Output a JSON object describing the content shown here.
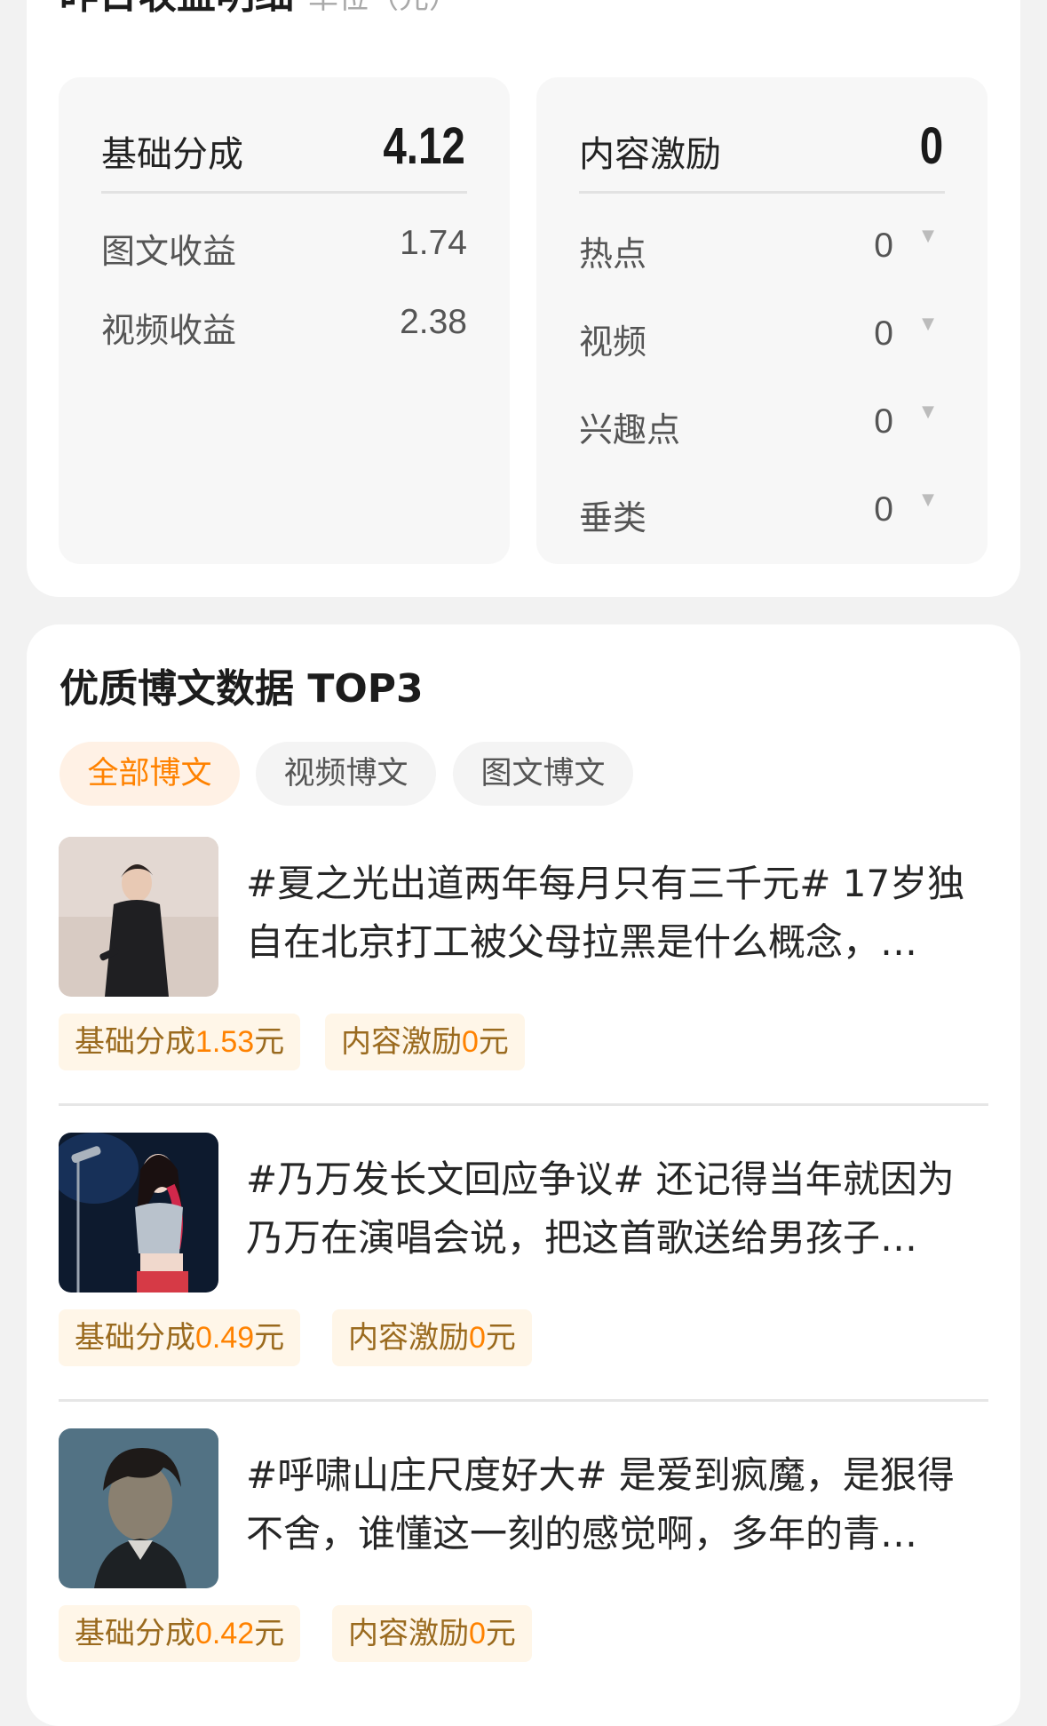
{
  "earnings": {
    "title": "昨日收益明细",
    "unit": "单位（元）",
    "basic": {
      "label": "基础分成",
      "total": "4.12",
      "items": [
        {
          "label": "图文收益",
          "value": "1.74"
        },
        {
          "label": "视频收益",
          "value": "2.38"
        }
      ]
    },
    "incentive": {
      "label": "内容激励",
      "total": "0",
      "items": [
        {
          "label": "热点",
          "value": "0"
        },
        {
          "label": "视频",
          "value": "0"
        },
        {
          "label": "兴趣点",
          "value": "0"
        },
        {
          "label": "垂类",
          "value": "0"
        }
      ]
    }
  },
  "top3": {
    "title": "优质博文数据 TOP3",
    "tabs": [
      {
        "label": "全部博文",
        "active": true
      },
      {
        "label": "视频博文",
        "active": false
      },
      {
        "label": "图文博文",
        "active": false
      }
    ],
    "posts": [
      {
        "line1": "#夏之光出道两年每月只有三千元# 17岁独",
        "line2": "自在北京打工被父母拉黑是什么概念，…",
        "basic_label": "基础分成",
        "basic_amount": "1.53",
        "incentive_label": "内容激励",
        "incentive_amount": "0",
        "currency": "元"
      },
      {
        "line1": "#乃万发长文回应争议# 还记得当年就因为",
        "line2": "乃万在演唱会说，把这首歌送给男孩子…",
        "basic_label": "基础分成",
        "basic_amount": "0.49",
        "incentive_label": "内容激励",
        "incentive_amount": "0",
        "currency": "元"
      },
      {
        "line1": "#呼啸山庄尺度好大# 是爱到疯魔，是狠得",
        "line2": "不舍，谁懂这一刻的感觉啊，多年的青…",
        "basic_label": "基础分成",
        "basic_amount": "0.42",
        "incentive_label": "内容激励",
        "incentive_amount": "0",
        "currency": "元"
      }
    ]
  }
}
